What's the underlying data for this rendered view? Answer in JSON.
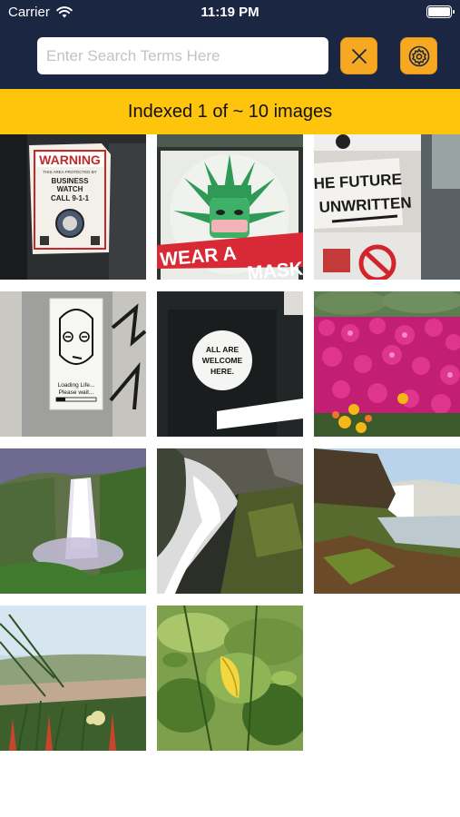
{
  "status": {
    "carrier": "Carrier",
    "time": "11:19 PM",
    "icons": [
      "wifi-icon",
      "battery-icon"
    ]
  },
  "search": {
    "placeholder": "Enter Search Terms Here",
    "value": ""
  },
  "toolbar": {
    "clear_icon": "close-icon",
    "settings_icon": "gear-icon"
  },
  "banner": {
    "text": "Indexed 1 of ~ 10 images"
  },
  "colors": {
    "header": "#1b2643",
    "accent": "#f6a920",
    "banner": "#fec50c"
  },
  "thumbnails": [
    {
      "name": "warning-sticker",
      "text": [
        "WARNING",
        "THIS AREA PROTECTED BY",
        "BUSINESS",
        "WATCH",
        "CALL 9-1-1"
      ]
    },
    {
      "name": "wear-a-mask-sticker",
      "text": [
        "WEAR A",
        "MASK!"
      ]
    },
    {
      "name": "future-unwritten-sticker",
      "text": [
        "HE FUTURE",
        "UNWRITTEN"
      ]
    },
    {
      "name": "loading-life-sticker",
      "text": [
        "Loading Life...",
        "Please wait..."
      ]
    },
    {
      "name": "all-welcome-sticker",
      "text": [
        "ALL ARE",
        "WELCOME",
        "HERE."
      ]
    },
    {
      "name": "pink-flowers-photo",
      "text": []
    },
    {
      "name": "waterfall-valley-photo",
      "text": []
    },
    {
      "name": "waterfall-rocks-photo",
      "text": []
    },
    {
      "name": "waterfall-cliff-photo",
      "text": []
    },
    {
      "name": "coastal-plants-photo",
      "text": []
    },
    {
      "name": "green-leaves-photo",
      "text": []
    }
  ]
}
